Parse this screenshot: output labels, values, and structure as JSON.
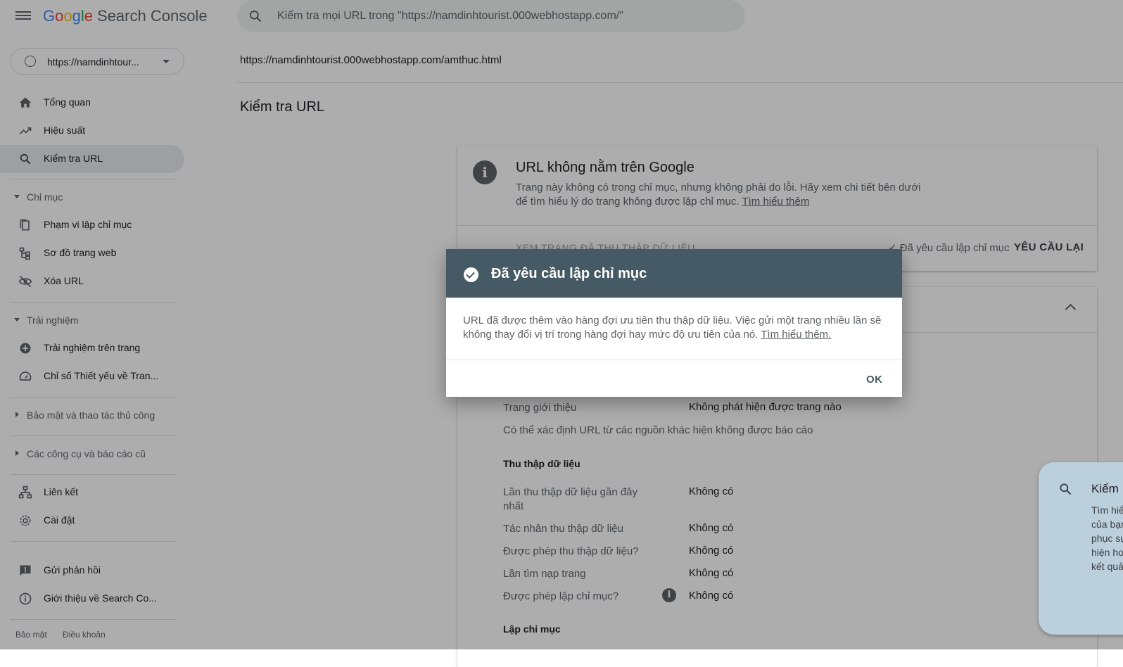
{
  "header": {
    "logo_letters": [
      "G",
      "o",
      "o",
      "g",
      "l",
      "e"
    ],
    "product": "Search Console",
    "search_placeholder": "Kiểm tra mọi URL trong \"https://namdinhtourist.000webhostapp.com/\""
  },
  "sidebar": {
    "property": "https://namdinhtour...",
    "top_items": [
      {
        "label": "Tổng quan",
        "icon": "home-icon"
      },
      {
        "label": "Hiệu suất",
        "icon": "trending-icon"
      },
      {
        "label": "Kiểm tra URL",
        "icon": "search-icon",
        "active": true
      }
    ],
    "section_index": {
      "label": "Chỉ mục",
      "items": [
        {
          "label": "Phạm vi lập chỉ mục",
          "icon": "pages-icon"
        },
        {
          "label": "Sơ đồ trang web",
          "icon": "sitemap-icon"
        },
        {
          "label": "Xóa URL",
          "icon": "hidden-eye-icon"
        }
      ]
    },
    "section_experience": {
      "label": "Trải nghiệm",
      "items": [
        {
          "label": "Trải nghiệm trên trang",
          "icon": "plus-circle-icon"
        },
        {
          "label": "Chỉ số Thiết yếu về Tran...",
          "icon": "gauge-icon"
        }
      ]
    },
    "section_security": "Bảo mật và thao tác thủ công",
    "section_legacy": "Các công cụ và báo cáo cũ",
    "bottom_items": [
      {
        "label": "Liên kết",
        "icon": "links-icon"
      },
      {
        "label": "Cài đặt",
        "icon": "gear-icon"
      }
    ],
    "footer_items": [
      {
        "label": "Gửi phản hồi",
        "icon": "feedback-icon"
      },
      {
        "label": "Giới thiệu về Search Co...",
        "icon": "info-icon"
      }
    ],
    "legal": {
      "privacy": "Bảo mật",
      "terms": "Điều khoản"
    }
  },
  "main": {
    "inspected_url": "https://namdinhtourist.000webhostapp.com/amthuc.html",
    "page_title": "Kiểm tra URL",
    "status_card": {
      "title": "URL không nằm trên Google",
      "desc": "Trang này không có trong chỉ mục, nhưng không phải do lỗi. Hãy xem chi tiết bên dưới để tìm hiểu lý do trang không được lập chỉ mục.",
      "learn_more": "Tìm hiểu thêm",
      "view_crawled": "XEM TRANG ĐÃ THU THẬP DỮ LIỆU",
      "requested": "✓ Đã yêu cầu lập chỉ mục",
      "request_again": "YÊU CẦU LẠI"
    },
    "details": {
      "referring_label": "Trang giới thiệu",
      "referring_value": "Không phát hiện được trang nào",
      "other_sources": "Có thể xác định URL từ các nguồn khác hiện không được báo cáo",
      "crawl_heading": "Thu thập dữ liệu",
      "crawl_rows": [
        {
          "label": "Lần thu thập dữ liệu gần đây nhất",
          "value": "Không có"
        },
        {
          "label": "Tác nhân thu thập dữ liệu",
          "value": "Không có"
        },
        {
          "label": "Được phép thu thập dữ liệu?",
          "value": "Không có"
        },
        {
          "label": "Lần tìm nạp trang",
          "value": "Không có"
        },
        {
          "label": "Được phép lập chỉ mục?",
          "value": "Không có"
        }
      ],
      "index_heading": "Lập chỉ mục"
    }
  },
  "side_panel": {
    "title": "Kiểm",
    "body": "Tìm hiể\ncủa bạn\nphục sự\nhiện hơ\nkết quả"
  },
  "dialog": {
    "title": "Đã yêu cầu lập chỉ mục",
    "body": "URL đã được thêm vào hàng đợi ưu tiên thu thập dữ liệu. Việc gửi một trang nhiều lần sẽ không thay đổi vị trí trong hàng đợi hay mức độ ưu tiên của nó.",
    "learn_more": "Tìm hiểu thêm.",
    "ok": "OK"
  }
}
